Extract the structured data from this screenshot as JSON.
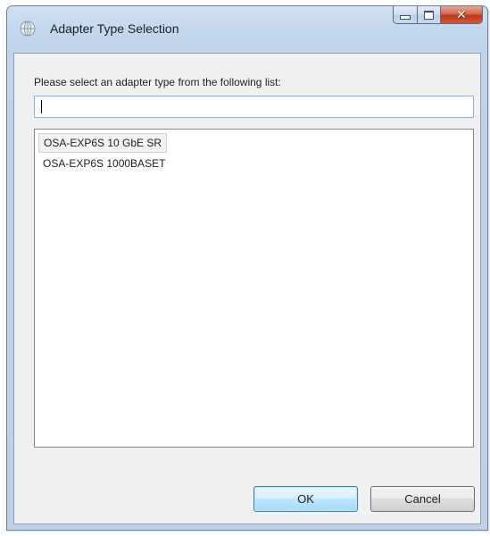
{
  "window": {
    "title": "Adapter Type Selection",
    "icon": "globe-icon",
    "caption_buttons": [
      "minimize-icon",
      "maximize-icon",
      "close-icon"
    ]
  },
  "dialog": {
    "prompt": "Please select an adapter type from the following list:",
    "filter_value": "",
    "filter_placeholder": "",
    "items": [
      {
        "label": "OSA-EXP6S 10 GbE SR",
        "selected": true
      },
      {
        "label": "OSA-EXP6S 1000BASET",
        "selected": false
      }
    ],
    "ok_label": "OK",
    "cancel_label": "Cancel"
  },
  "colors": {
    "frame": "#bcd1e8",
    "client": "#f0f0f0",
    "close_button": "#c2351a",
    "default_button_border": "#3c7fb1"
  }
}
